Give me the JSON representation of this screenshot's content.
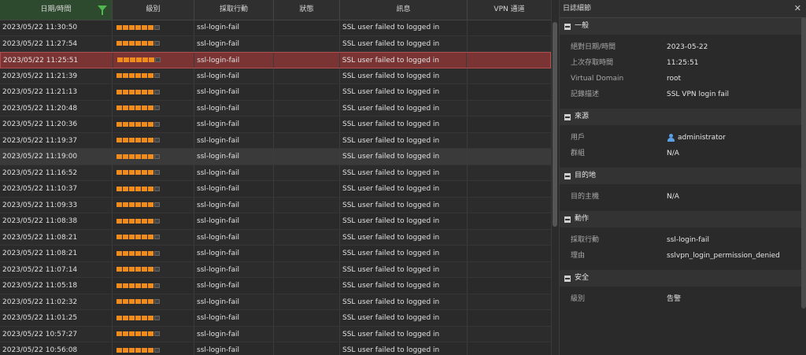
{
  "colors": {
    "accent_green": "#4fb84f",
    "level_orange": "#f08c1c",
    "selected_row": "#7a3434",
    "user_icon": "#5aa0e6"
  },
  "log_table": {
    "columns": [
      "日期/時間",
      "級別",
      "採取行動",
      "狀態",
      "訊息",
      "VPN 通道"
    ],
    "rows": [
      {
        "datetime": "2023/05/22 11:30:50",
        "level": 6,
        "action": "ssl-login-fail",
        "status": "",
        "message": "SSL user failed to logged in",
        "vpn": ""
      },
      {
        "datetime": "2023/05/22 11:27:54",
        "level": 6,
        "action": "ssl-login-fail",
        "status": "",
        "message": "SSL user failed to logged in",
        "vpn": ""
      },
      {
        "datetime": "2023/05/22 11:25:51",
        "level": 6,
        "action": "ssl-login-fail",
        "status": "",
        "message": "SSL user failed to logged in",
        "vpn": ""
      },
      {
        "datetime": "2023/05/22 11:21:39",
        "level": 6,
        "action": "ssl-login-fail",
        "status": "",
        "message": "SSL user failed to logged in",
        "vpn": ""
      },
      {
        "datetime": "2023/05/22 11:21:13",
        "level": 6,
        "action": "ssl-login-fail",
        "status": "",
        "message": "SSL user failed to logged in",
        "vpn": ""
      },
      {
        "datetime": "2023/05/22 11:20:48",
        "level": 6,
        "action": "ssl-login-fail",
        "status": "",
        "message": "SSL user failed to logged in",
        "vpn": ""
      },
      {
        "datetime": "2023/05/22 11:20:36",
        "level": 6,
        "action": "ssl-login-fail",
        "status": "",
        "message": "SSL user failed to logged in",
        "vpn": ""
      },
      {
        "datetime": "2023/05/22 11:19:37",
        "level": 6,
        "action": "ssl-login-fail",
        "status": "",
        "message": "SSL user failed to logged in",
        "vpn": ""
      },
      {
        "datetime": "2023/05/22 11:19:00",
        "level": 6,
        "action": "ssl-login-fail",
        "status": "",
        "message": "SSL user failed to logged in",
        "vpn": ""
      },
      {
        "datetime": "2023/05/22 11:16:52",
        "level": 6,
        "action": "ssl-login-fail",
        "status": "",
        "message": "SSL user failed to logged in",
        "vpn": ""
      },
      {
        "datetime": "2023/05/22 11:10:37",
        "level": 6,
        "action": "ssl-login-fail",
        "status": "",
        "message": "SSL user failed to logged in",
        "vpn": ""
      },
      {
        "datetime": "2023/05/22 11:09:33",
        "level": 6,
        "action": "ssl-login-fail",
        "status": "",
        "message": "SSL user failed to logged in",
        "vpn": ""
      },
      {
        "datetime": "2023/05/22 11:08:38",
        "level": 6,
        "action": "ssl-login-fail",
        "status": "",
        "message": "SSL user failed to logged in",
        "vpn": ""
      },
      {
        "datetime": "2023/05/22 11:08:21",
        "level": 6,
        "action": "ssl-login-fail",
        "status": "",
        "message": "SSL user failed to logged in",
        "vpn": ""
      },
      {
        "datetime": "2023/05/22 11:08:21",
        "level": 6,
        "action": "ssl-login-fail",
        "status": "",
        "message": "SSL user failed to logged in",
        "vpn": ""
      },
      {
        "datetime": "2023/05/22 11:07:14",
        "level": 6,
        "action": "ssl-login-fail",
        "status": "",
        "message": "SSL user failed to logged in",
        "vpn": ""
      },
      {
        "datetime": "2023/05/22 11:05:18",
        "level": 6,
        "action": "ssl-login-fail",
        "status": "",
        "message": "SSL user failed to logged in",
        "vpn": ""
      },
      {
        "datetime": "2023/05/22 11:02:32",
        "level": 6,
        "action": "ssl-login-fail",
        "status": "",
        "message": "SSL user failed to logged in",
        "vpn": ""
      },
      {
        "datetime": "2023/05/22 11:01:25",
        "level": 6,
        "action": "ssl-login-fail",
        "status": "",
        "message": "SSL user failed to logged in",
        "vpn": ""
      },
      {
        "datetime": "2023/05/22 10:57:27",
        "level": 6,
        "action": "ssl-login-fail",
        "status": "",
        "message": "SSL user failed to logged in",
        "vpn": ""
      },
      {
        "datetime": "2023/05/22 10:56:08",
        "level": 6,
        "action": "ssl-login-fail",
        "status": "",
        "message": "SSL user failed to logged in",
        "vpn": ""
      }
    ],
    "level_max": 7,
    "selected_index": 2,
    "hover_index": 8
  },
  "detail": {
    "title": "日誌細節",
    "close_icon": "close-icon",
    "sections": [
      {
        "key": "general",
        "title": "一般",
        "items": [
          {
            "label": "絕對日期/時間",
            "value": "2023-05-22"
          },
          {
            "label": "上次存取時間",
            "value": "11:25:51"
          },
          {
            "label": "Virtual Domain",
            "value": "root"
          },
          {
            "label": "記錄描述",
            "value": "SSL VPN login fail"
          }
        ]
      },
      {
        "key": "source",
        "title": "來源",
        "items": [
          {
            "label": "用戶",
            "value": "administrator",
            "icon": "user-icon"
          },
          {
            "label": "群組",
            "value": "N/A"
          }
        ]
      },
      {
        "key": "destination",
        "title": "目的地",
        "items": [
          {
            "label": "目的主機",
            "value": "N/A"
          }
        ]
      },
      {
        "key": "action",
        "title": "動作",
        "items": [
          {
            "label": "採取行動",
            "value": "ssl-login-fail"
          },
          {
            "label": "理由",
            "value": "sslvpn_login_permission_denied"
          }
        ]
      },
      {
        "key": "security",
        "title": "安全",
        "items": [
          {
            "label": "級別",
            "value": "告警"
          }
        ]
      }
    ]
  }
}
